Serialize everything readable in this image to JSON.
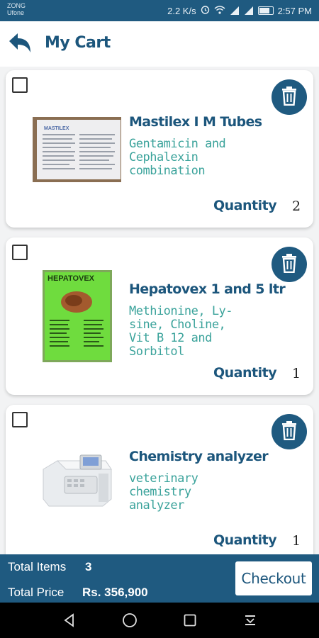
{
  "status_bar": {
    "carrier_1": "ZONG",
    "carrier_2": "Ufone",
    "speed": "2.2 K/s",
    "time": "2:57 PM",
    "icons": [
      "alarm-icon",
      "wifi-icon",
      "signal-icon",
      "signal-icon",
      "battery-icon"
    ]
  },
  "header": {
    "title": "My Cart",
    "back_icon": "back-arrow-icon"
  },
  "items": [
    {
      "name": "Mastilex I M Tubes",
      "description": "Gentamicin and Cephalexin combination",
      "quantity_label": "Quantity",
      "quantity": "2",
      "thumbnail_text": "MASTILEX",
      "checked": false
    },
    {
      "name": "Hepatovex 1 and 5 ltr",
      "description": "Methionine, Ly-sine, Choline, Vit B 12 and Sorbitol",
      "quantity_label": "Quantity",
      "quantity": "1",
      "thumbnail_text": "HEPATOVEX",
      "checked": false
    },
    {
      "name": "Chemistry analyzer",
      "description": "veterinary chemistry analyzer",
      "quantity_label": "Quantity",
      "quantity": "1",
      "checked": false
    }
  ],
  "footer": {
    "total_items_label": "Total Items",
    "total_items": "3",
    "total_price_label": "Total Price",
    "total_price": "Rs. 356,900",
    "checkout_label": "Checkout"
  },
  "colors": {
    "primary": "#1f5a80",
    "title_text": "#1c567c",
    "description_text": "#3ba39b"
  }
}
